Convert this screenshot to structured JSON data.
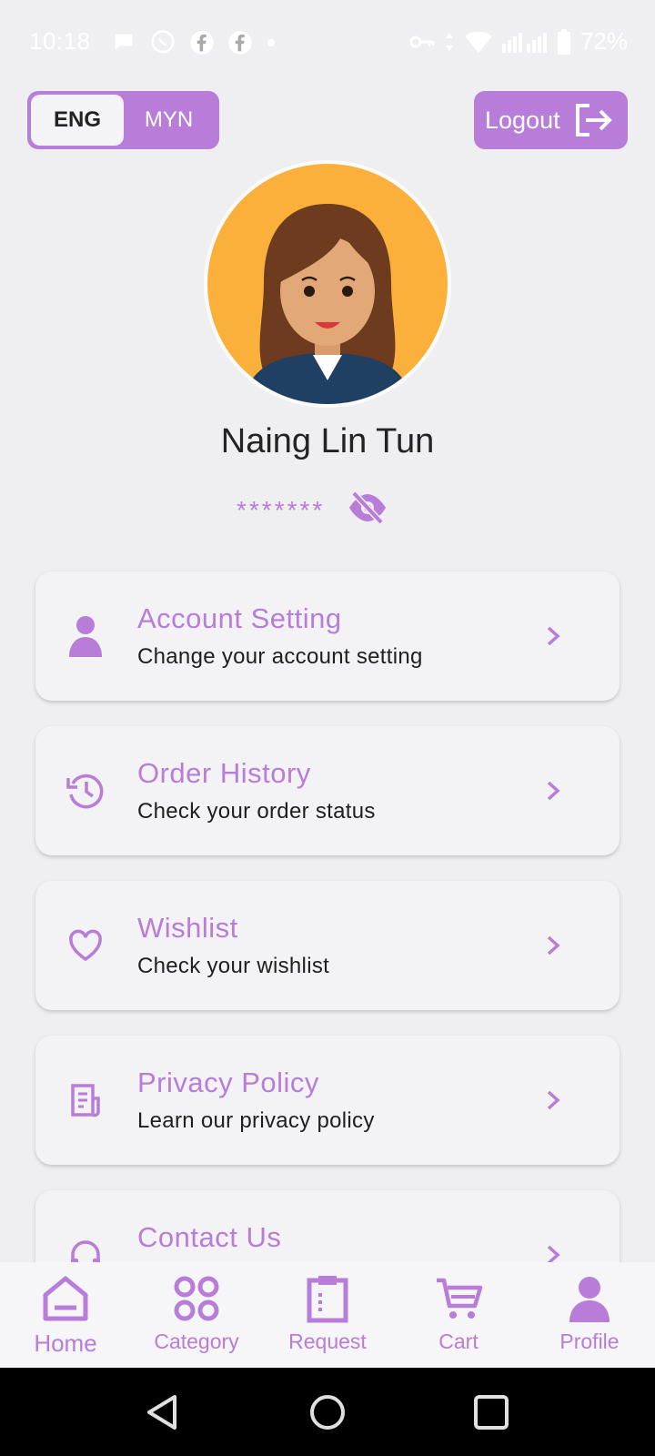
{
  "status_bar": {
    "time": "10:18",
    "battery": "72%"
  },
  "language": {
    "options": [
      "ENG",
      "MYN"
    ],
    "selected": "ENG"
  },
  "header": {
    "logout_label": "Logout"
  },
  "profile": {
    "name": "Naing Lin Tun",
    "password_mask": "*******"
  },
  "menu": [
    {
      "title": "Account Setting",
      "subtitle": "Change your account setting",
      "icon": "person-icon"
    },
    {
      "title": "Order History",
      "subtitle": "Check your order status",
      "icon": "history-icon"
    },
    {
      "title": "Wishlist",
      "subtitle": "Check your wishlist",
      "icon": "heart-icon"
    },
    {
      "title": "Privacy Policy",
      "subtitle": "Learn our privacy policy",
      "icon": "document-icon"
    },
    {
      "title": "Contact Us",
      "subtitle": "",
      "icon": "headset-icon"
    }
  ],
  "bottom_nav": [
    {
      "label": "Home",
      "icon": "home-icon"
    },
    {
      "label": "Category",
      "icon": "category-icon"
    },
    {
      "label": "Request",
      "icon": "clipboard-icon"
    },
    {
      "label": "Cart",
      "icon": "cart-icon"
    },
    {
      "label": "Profile",
      "icon": "profile-icon"
    }
  ],
  "colors": {
    "accent": "#b87dd8",
    "background": "#efeef0",
    "avatar_bg": "#fbb03b"
  }
}
